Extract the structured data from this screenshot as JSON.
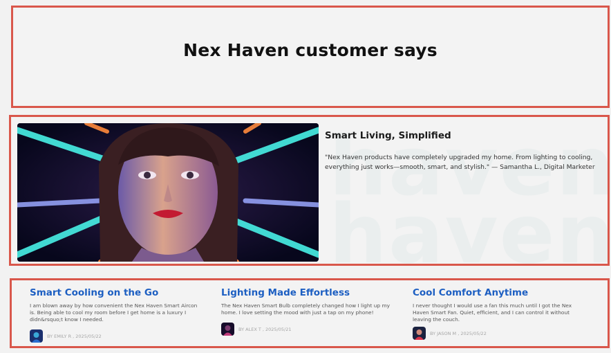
{
  "hero": {
    "title": "Nex Haven customer says"
  },
  "feature": {
    "title": "Smart Living, Simplified",
    "quote": "\"Nex Haven products have completely upgraded my home. From lighting to cooling, everything just works—smooth, smart, and stylish.\"  — Samantha L., Digital Marketer",
    "watermark": "haven",
    "image_desc": "portrait-photo"
  },
  "cards": [
    {
      "title": "Smart Cooling on the Go",
      "body": "I am blown away by how convenient the Nex Haven Smart Aircon is. Being able to cool my room before I get home is a luxury I didn&rsquo;t know I needed.",
      "byline": "BY EMILY R , 2025/05/22"
    },
    {
      "title": "Lighting Made Effortless",
      "body": "The Nex Haven Smart Bulb completely changed how I light up my home. I love setting the mood with just a tap on my phone!",
      "byline": "BY ALEX T , 2025/05/21"
    },
    {
      "title": "Cool Comfort Anytime",
      "body": "I never thought I would use a fan this much until I got the Nex Haven Smart Fan. Quiet, efficient, and I can control it without leaving the couch.",
      "byline": "BY JASON M , 2025/05/22"
    }
  ],
  "colors": {
    "accent": "#1d5fc2",
    "border": "#d9574b"
  }
}
